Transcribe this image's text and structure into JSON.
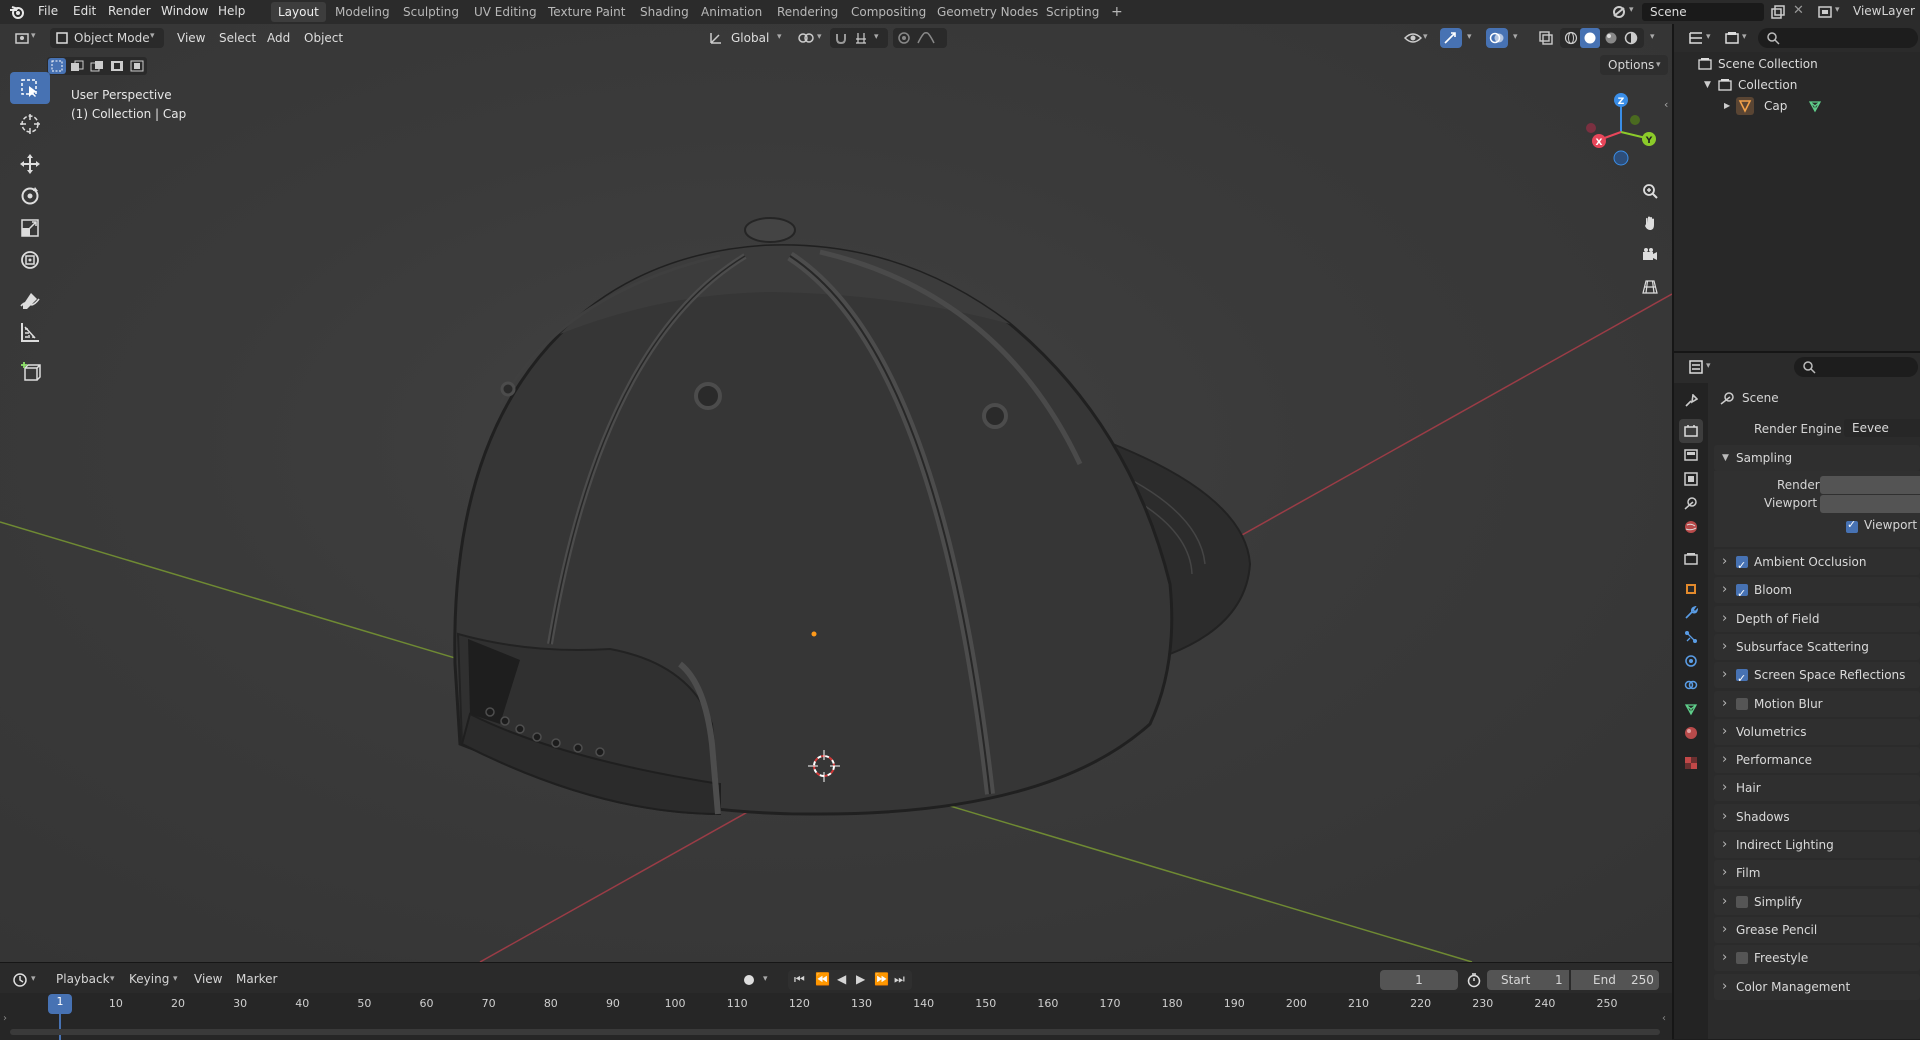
{
  "topbar": {
    "menus": [
      "File",
      "Edit",
      "Render",
      "Window",
      "Help"
    ],
    "workspaces": [
      "Layout",
      "Modeling",
      "Sculpting",
      "UV Editing",
      "Texture Paint",
      "Shading",
      "Animation",
      "Rendering",
      "Compositing",
      "Geometry Nodes",
      "Scripting"
    ],
    "active_workspace": "Layout",
    "add_tab": "+",
    "scene_name": "Scene",
    "view_layer": "ViewLayer"
  },
  "viewport": {
    "mode": "Object Mode",
    "menus": [
      "View",
      "Select",
      "Add",
      "Object"
    ],
    "orientation": "Global",
    "options_label": "Options",
    "overlay_title": "User Perspective",
    "overlay_subtitle": "(1) Collection | Cap",
    "gizmo_axes": {
      "x": "X",
      "y": "Y",
      "z": "Z"
    },
    "colors": {
      "x_axis": "#e8465a",
      "y_axis": "#8ccb2a",
      "z_axis": "#3a8ee8",
      "active_tool": "#4772b3"
    }
  },
  "toolbar": {
    "tools": [
      "select-box-icon",
      "cursor-icon",
      "move-icon",
      "rotate-icon",
      "scale-icon",
      "transform-icon",
      "annotate-icon",
      "measure-icon",
      "add-cube-icon"
    ]
  },
  "timeline": {
    "menus": [
      "Playback",
      "Keying",
      "View",
      "Marker"
    ],
    "current_frame": "1",
    "start_label": "Start",
    "start_value": "1",
    "end_label": "End",
    "end_value": "250",
    "ruler": [
      "1",
      "10",
      "20",
      "30",
      "40",
      "50",
      "60",
      "70",
      "80",
      "90",
      "100",
      "110",
      "120",
      "130",
      "140",
      "150",
      "160",
      "170",
      "180",
      "190",
      "200",
      "210",
      "220",
      "230",
      "240",
      "250"
    ]
  },
  "outliner": {
    "rows": [
      {
        "label": "Scene Collection"
      },
      {
        "label": "Collection"
      },
      {
        "label": "Cap"
      }
    ]
  },
  "properties": {
    "context_name": "Scene",
    "render_engine_label": "Render Engine",
    "render_engine_value": "Eevee",
    "sampling_label": "Sampling",
    "render_label": "Render",
    "viewport_label": "Viewport",
    "viewport_denoise_label": "Viewport Denoising",
    "panels": [
      {
        "label": "Ambient Occlusion",
        "checkbox": true,
        "checked": true
      },
      {
        "label": "Bloom",
        "checkbox": true,
        "checked": true
      },
      {
        "label": "Depth of Field",
        "checkbox": false,
        "checked": false
      },
      {
        "label": "Subsurface Scattering",
        "checkbox": false,
        "checked": false
      },
      {
        "label": "Screen Space Reflections",
        "checkbox": true,
        "checked": true
      },
      {
        "label": "Motion Blur",
        "checkbox": true,
        "checked": false
      },
      {
        "label": "Volumetrics",
        "checkbox": false,
        "checked": false
      },
      {
        "label": "Performance",
        "checkbox": false,
        "checked": false
      },
      {
        "label": "Hair",
        "checkbox": false,
        "checked": false
      },
      {
        "label": "Shadows",
        "checkbox": false,
        "checked": false
      },
      {
        "label": "Indirect Lighting",
        "checkbox": false,
        "checked": false
      },
      {
        "label": "Film",
        "checkbox": false,
        "checked": false
      },
      {
        "label": "Simplify",
        "checkbox": true,
        "checked": false
      },
      {
        "label": "Grease Pencil",
        "checkbox": false,
        "checked": false
      },
      {
        "label": "Freestyle",
        "checkbox": true,
        "checked": false
      },
      {
        "label": "Color Management",
        "checkbox": false,
        "checked": false
      }
    ]
  }
}
